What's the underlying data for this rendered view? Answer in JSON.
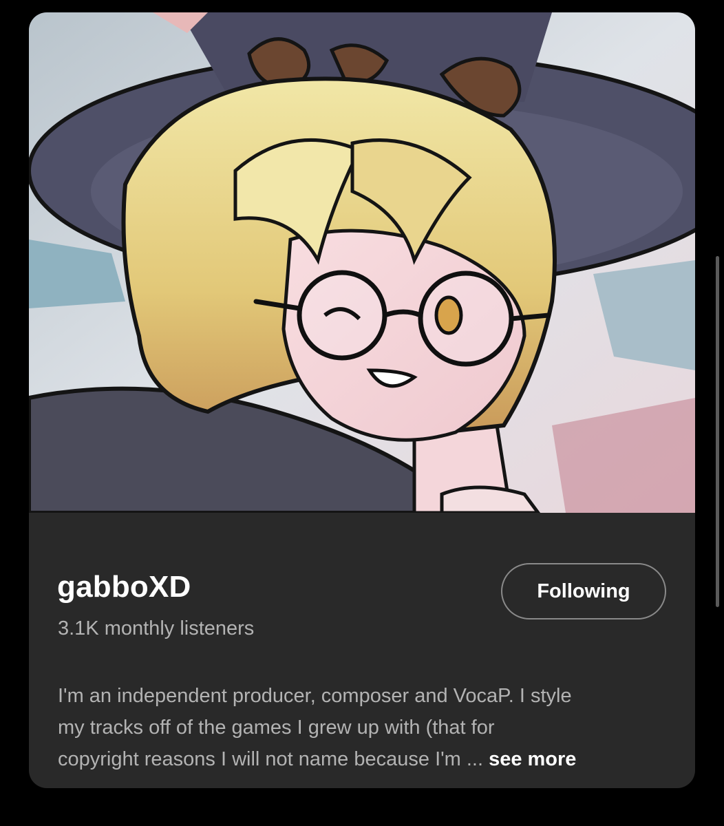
{
  "artist": {
    "name": "gabboXD",
    "monthly_listeners": "3.1K monthly listeners",
    "artwork_icon": "artist-portrait-image"
  },
  "follow_button": {
    "label": "Following"
  },
  "bio": {
    "line1": "I'm an independent producer, composer and VocaP. I style",
    "line2": "my tracks off of the games I grew up with (that for",
    "line3": "copyright reasons I will not name because I'm ...",
    "see_more": "see more"
  },
  "colors": {
    "background": "#000000",
    "card": "#292929",
    "primary_text": "#ffffff",
    "secondary_text": "#b3b3b3",
    "button_border": "#8a8a8a"
  }
}
